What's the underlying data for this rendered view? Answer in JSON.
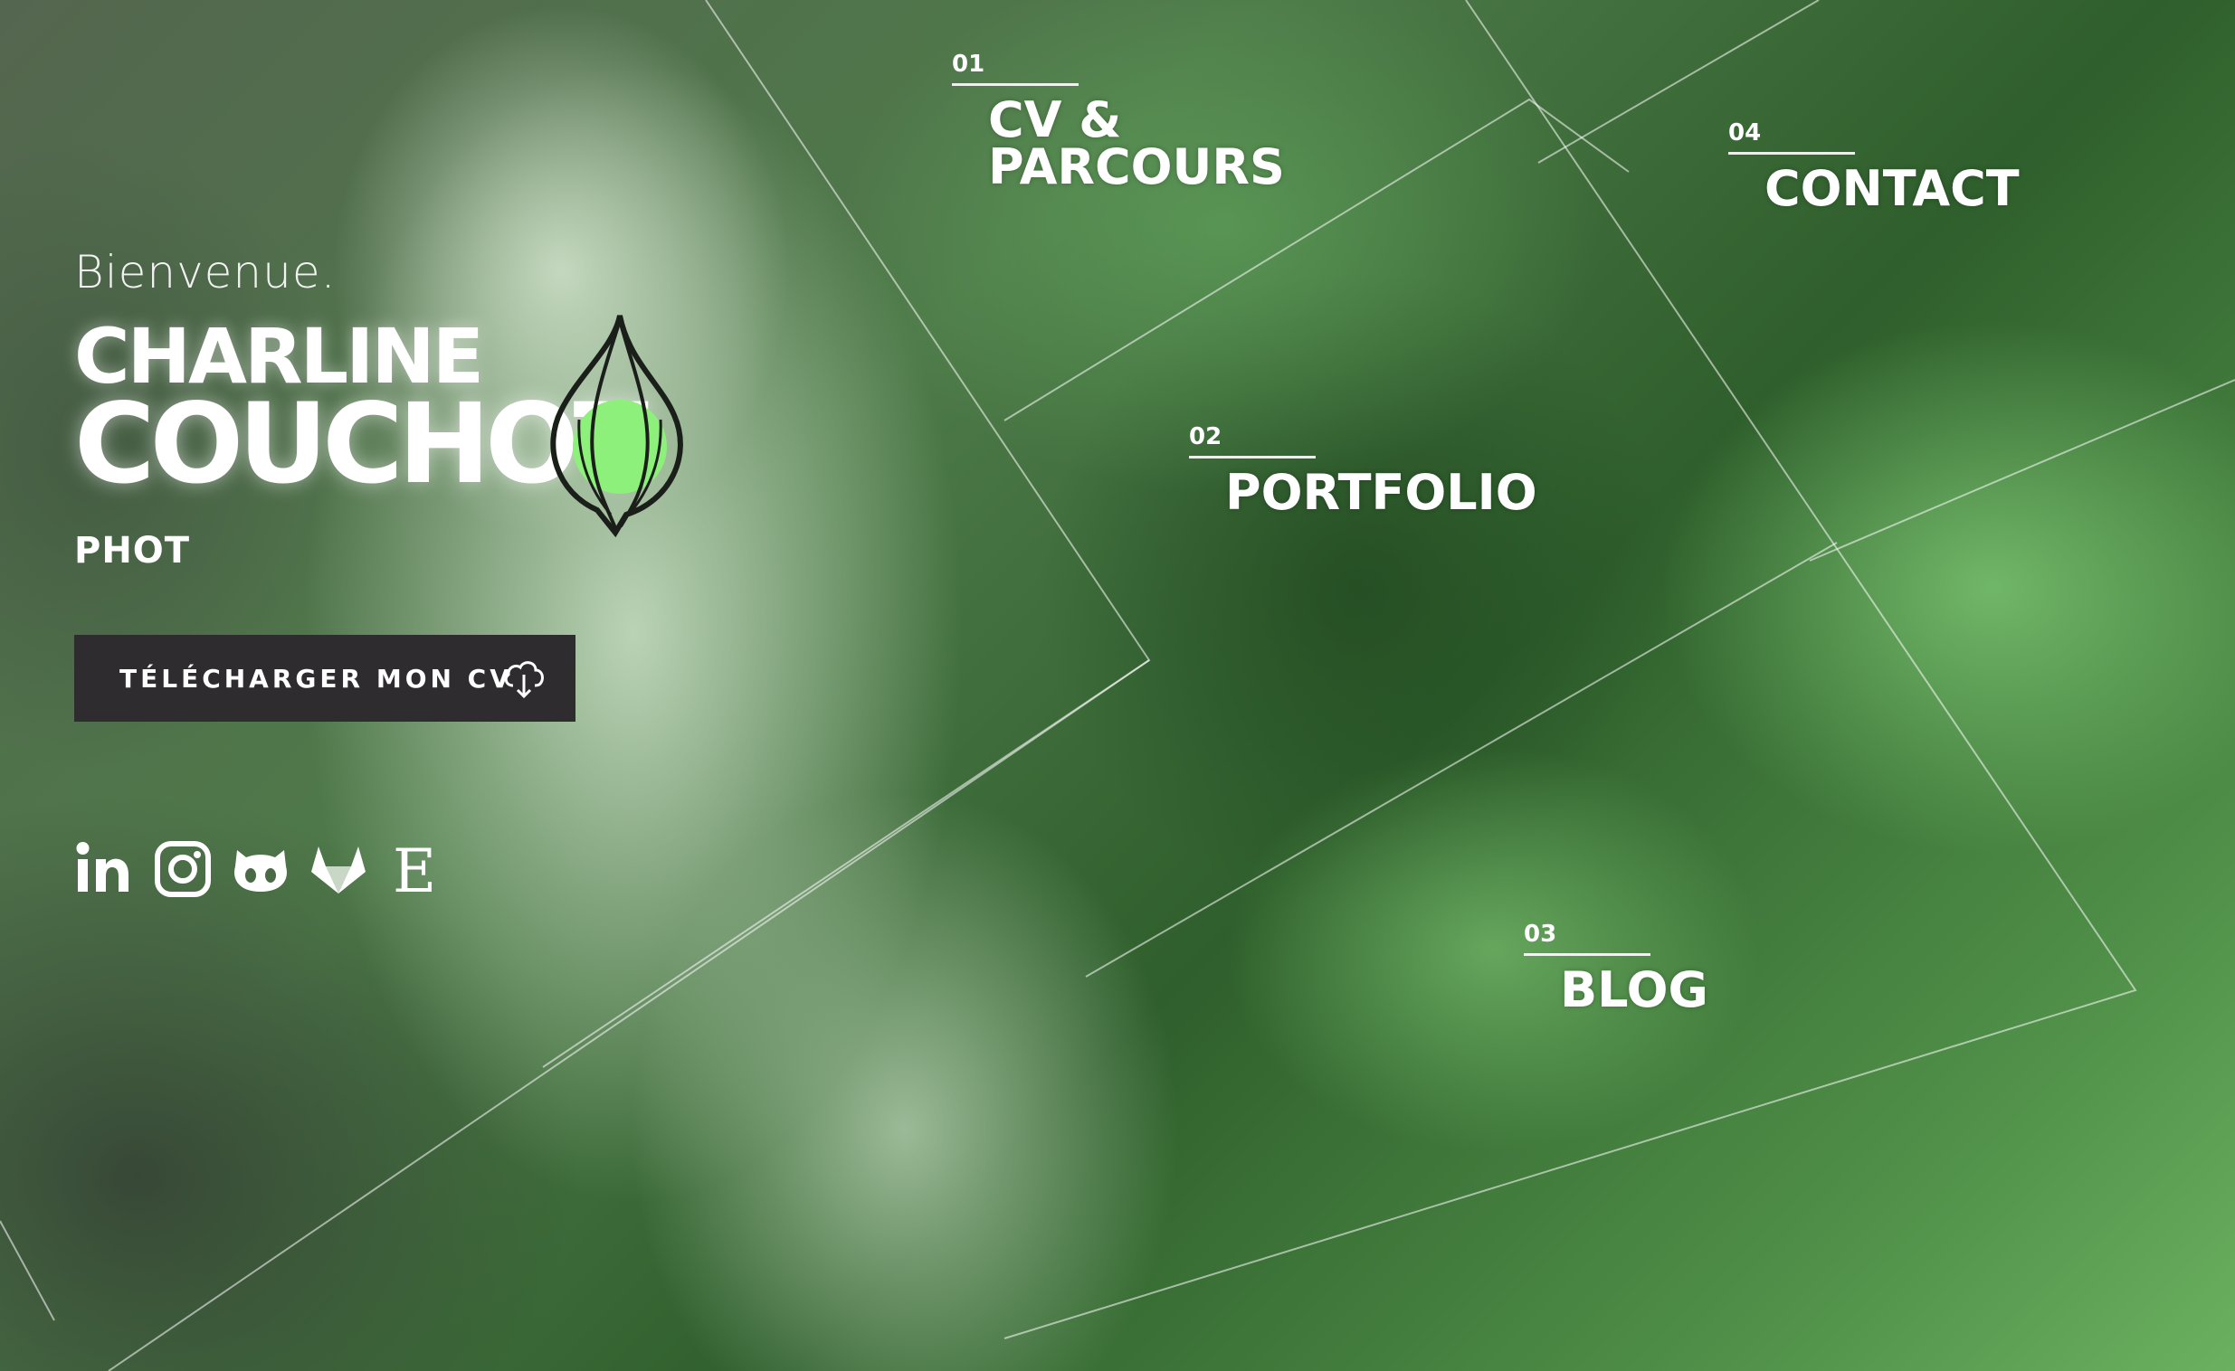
{
  "hero": {
    "greeting": "Bienvenue.",
    "first_name": "CHARLINE",
    "last_name": "COUCHOT",
    "job_title": "PHOT",
    "cv_button_label": "TÉLÉCHARGER MON CV",
    "cv_button_icon": "cloud-download-icon"
  },
  "social": [
    {
      "name": "linkedin-icon",
      "label": "LinkedIn"
    },
    {
      "name": "instagram-icon",
      "label": "Instagram"
    },
    {
      "name": "github-icon",
      "label": "GitHub"
    },
    {
      "name": "gitlab-icon",
      "label": "GitLab"
    },
    {
      "name": "etsy-icon",
      "label": "Etsy"
    }
  ],
  "nav": [
    {
      "number": "01",
      "label": "CV &\nPARCOURS"
    },
    {
      "number": "02",
      "label": "PORTFOLIO"
    },
    {
      "number": "03",
      "label": "BLOG"
    },
    {
      "number": "04",
      "label": "CONTACT"
    }
  ],
  "colors": {
    "accent_green": "#8cf07a",
    "button_bg": "#2e2c2e",
    "text": "#ffffff"
  }
}
